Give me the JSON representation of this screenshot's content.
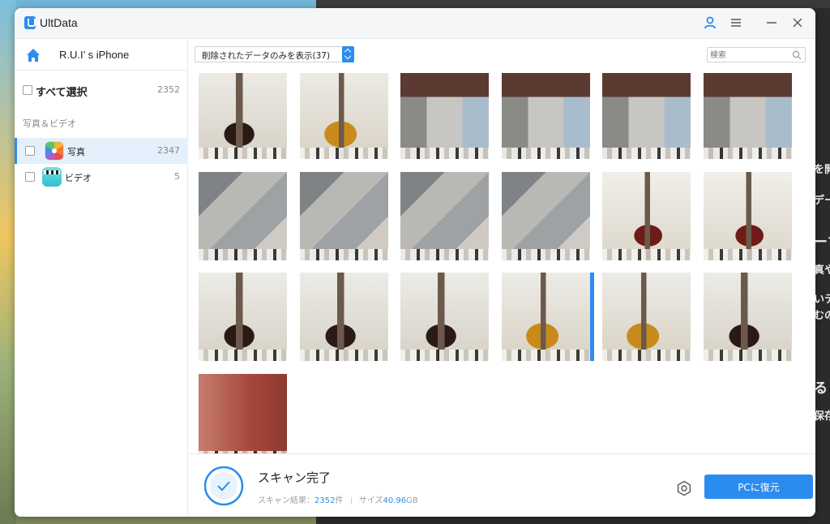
{
  "app": {
    "title": "UltData"
  },
  "device": {
    "name": "R.U.I’ s iPhone"
  },
  "sidebar": {
    "select_all": {
      "label": "すべて選択",
      "count": "2352"
    },
    "section_label": "写真＆ビデオ",
    "items": [
      {
        "label": "写真",
        "count": "2347",
        "icon": "photos-app-icon",
        "active": true
      },
      {
        "label": "ビデオ",
        "count": "5",
        "icon": "clips-video-icon",
        "active": false
      }
    ]
  },
  "toolbar": {
    "filter_label": "削除されたデータのみを表示(37)",
    "search_placeholder": "検索"
  },
  "thumbnails": [
    {
      "scene": "guitar-dark",
      "selected": false
    },
    {
      "scene": "guitar-orange",
      "selected": false
    },
    {
      "scene": "room-brown",
      "selected": false
    },
    {
      "scene": "room-brown",
      "selected": false
    },
    {
      "scene": "room-brown",
      "selected": false
    },
    {
      "scene": "room-brown",
      "selected": false
    },
    {
      "scene": "room-gray",
      "selected": false
    },
    {
      "scene": "room-gray",
      "selected": false
    },
    {
      "scene": "room-gray",
      "selected": false
    },
    {
      "scene": "room-gray",
      "selected": false
    },
    {
      "scene": "guitar-red",
      "selected": false
    },
    {
      "scene": "guitar-red",
      "selected": false
    },
    {
      "scene": "guitar-dark",
      "selected": false
    },
    {
      "scene": "guitar-dark",
      "selected": false
    },
    {
      "scene": "guitar-dark",
      "selected": false
    },
    {
      "scene": "guitar-orange",
      "selected": true
    },
    {
      "scene": "guitar-orange",
      "selected": false
    },
    {
      "scene": "guitar-dark",
      "selected": false
    },
    {
      "scene": "red-wall",
      "selected": false
    }
  ],
  "footer": {
    "title": "スキャン完了",
    "result_label": "スキャン結果：",
    "result_value": "2352",
    "result_unit": "件",
    "size_label": "サイズ",
    "size_value": "40.96",
    "size_unit": "GB",
    "recover_label": "PCに復元"
  },
  "colors": {
    "accent": "#2b8cf0"
  }
}
